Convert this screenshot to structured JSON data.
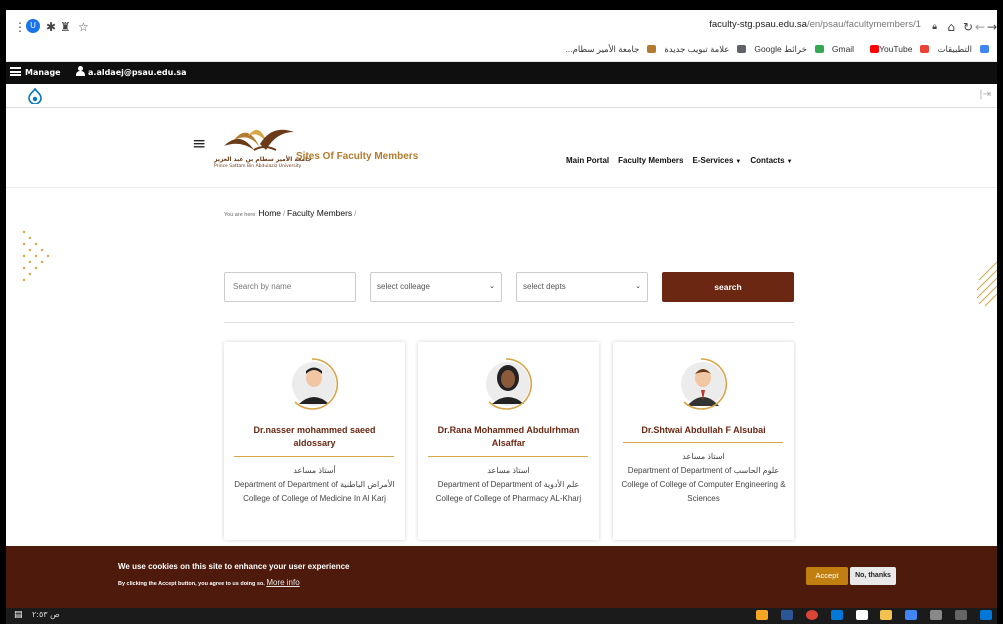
{
  "browser": {
    "url_main": "faculty-stg.psau.edu.sa",
    "url_path": "/en/psau/facultymembers/1",
    "bookmarks": [
      {
        "label": "التطبيقات",
        "icon": "apps-grid-icon"
      },
      {
        "label": "Gmail",
        "icon": "gmail-icon"
      },
      {
        "label": "YouTube",
        "icon": "youtube-icon"
      },
      {
        "label": "خرائط Google",
        "icon": "maps-icon"
      },
      {
        "label": "علامة تبويب جديدة",
        "icon": "globe-icon"
      },
      {
        "label": "جامعة الأمير سطام...",
        "icon": "university-icon"
      }
    ]
  },
  "admin": {
    "manage_label": "Manage",
    "user_email": "a.aldaej@psau.edu.sa"
  },
  "header": {
    "site_title": "Sites Of Faculty Members",
    "univ_ar": "جامعة الأمير سطام بن عبد العزيز",
    "univ_en": "Prince Sattam Bin Abdulaziz University",
    "nav": [
      {
        "label": "Main Portal",
        "dropdown": false
      },
      {
        "label": "Faculty Members",
        "dropdown": false
      },
      {
        "label": "E-Services",
        "dropdown": true
      },
      {
        "label": "Contacts",
        "dropdown": true
      }
    ]
  },
  "breadcrumb": {
    "prefix": "You are here:",
    "items": [
      "Home",
      "Faculty Members"
    ]
  },
  "filters": {
    "search_placeholder": "Search by name",
    "college_select": "select colleage",
    "dept_select": "select depts",
    "search_button": "search"
  },
  "faculty": [
    {
      "name": "Dr.nasser mohammed saeed aldossary",
      "title": "أستاذ مساعد",
      "department": "Department of Department of الأمراض الباطنية",
      "college": "College of College of Medicine In Al Karj",
      "avatar": "male-avatar-icon"
    },
    {
      "name": "Dr.Rana Mohammed Abdulrhman Alsaffar",
      "title": "استاذ مساعد",
      "department": "Department of Department of علم الأدوية",
      "college": "College of College of Pharmacy AL-Kharj",
      "avatar": "female-avatar-icon"
    },
    {
      "name": "Dr.Shtwai Abdullah F Alsubai",
      "title": "استاذ مساعد",
      "department": "Department of Department of علوم الحاسب",
      "college": "College of College of Computer Engineering & Sciences",
      "avatar": "businessman-avatar-icon"
    }
  ],
  "cookie": {
    "title": "We use cookies on this site to enhance your user experience",
    "text": "By clicking the Accept button, you agree to us doing so.",
    "more_link": "More info",
    "accept": "Accept",
    "decline": "No, thanks"
  },
  "taskbar": {
    "left_text": "ﺹ ٢:٥٣"
  },
  "colors": {
    "brand_dark": "#6b2712",
    "brand_gold": "#b27b2f",
    "cookie_bg": "#4d1a0b",
    "accept_btn": "#c17f12"
  }
}
